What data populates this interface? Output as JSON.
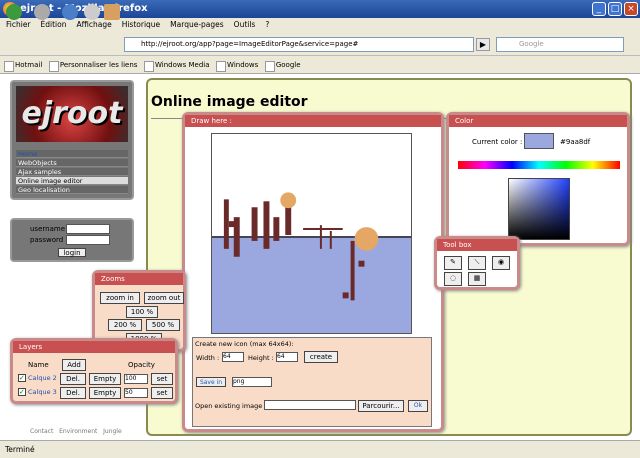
{
  "window": {
    "title": "ejroot - Mozilla Firefox"
  },
  "menu": [
    "Fichier",
    "Édition",
    "Affichage",
    "Historique",
    "Marque-pages",
    "Outils",
    "?"
  ],
  "url": "http://ejroot.org/app?page=ImageEditorPage&service=page#",
  "search": {
    "placeholder": "Google"
  },
  "bookmarks": [
    "Hotmail",
    "Personnaliser les liens",
    "Windows Media",
    "Windows",
    "Google"
  ],
  "status": "Terminé",
  "logo": "ejroot",
  "nav": [
    "Home",
    "WebObjects",
    "Ajax samples",
    "Online image editor",
    "Geo localisation"
  ],
  "login": {
    "username_label": "username",
    "password_label": "password",
    "button": "login"
  },
  "page_title": "Online image editor",
  "draw": {
    "title": "Draw here :",
    "new_icon": "Create new icon (max 64x64):",
    "width_label": "Width :",
    "width": "64",
    "height_label": "Height :",
    "height": "64",
    "create": "create",
    "save": "Save in",
    "format": "png",
    "open": "Open existing image",
    "browse": "Parcourir...",
    "ok": "Ok"
  },
  "color": {
    "title": "Color",
    "current_label": "Current color :",
    "current": "#9aa8df",
    "swatch": "#9aa8df"
  },
  "toolbox": {
    "title": "Tool box"
  },
  "zooms": {
    "title": "Zooms",
    "zoom_in": "zoom in",
    "zoom_out": "zoom out",
    "z100": "100 %",
    "z200": "200 %",
    "z500": "500 %",
    "z1000": "1000 %"
  },
  "layers": {
    "title": "Layers",
    "name_label": "Name",
    "add": "Add",
    "opacity_label": "Opacity",
    "rows": [
      {
        "name": "Calque 2",
        "del": "Del.",
        "empty": "Empty",
        "opacity": "100",
        "set": "set"
      },
      {
        "name": "Calque 3",
        "del": "Del.",
        "empty": "Empty",
        "opacity": "50",
        "set": "set"
      }
    ]
  },
  "footer": "Contact   Environment   Jungle"
}
